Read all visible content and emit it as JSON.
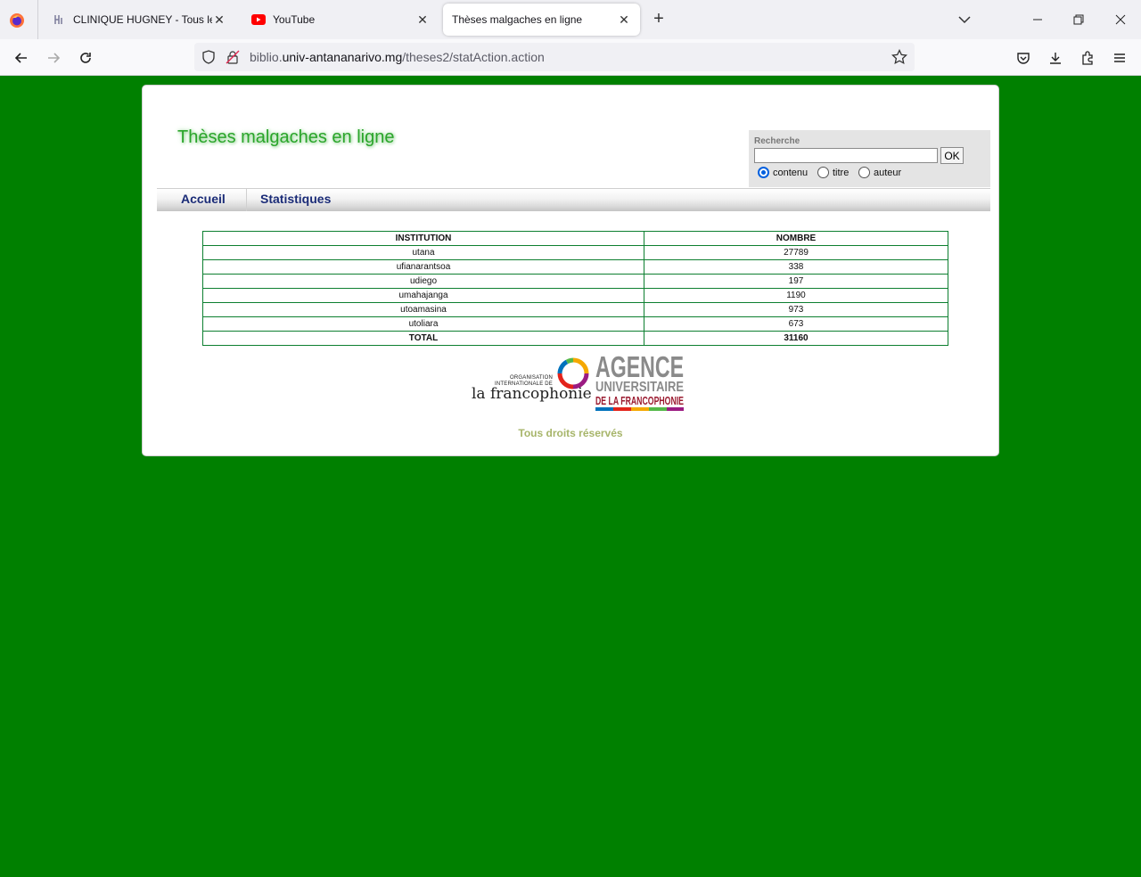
{
  "browser": {
    "tabs": [
      {
        "title": "CLINIQUE HUGNEY - Tous les fa",
        "icon": "clinique-favicon",
        "active": false
      },
      {
        "title": "YouTube",
        "icon": "youtube-icon",
        "active": false
      },
      {
        "title": "Thèses malgaches en ligne",
        "icon": "",
        "active": true
      }
    ],
    "url": {
      "prefix": "biblio.",
      "domain": "univ-antananarivo.mg",
      "path": "/theses2/statAction.action"
    }
  },
  "site": {
    "title": "Thèses malgaches en ligne",
    "search": {
      "label": "Recherche",
      "value": "",
      "button": "OK",
      "options": [
        "contenu",
        "titre",
        "auteur"
      ],
      "selected": "contenu"
    },
    "menu": [
      "Accueil",
      "Statistiques"
    ]
  },
  "stats": {
    "headers": [
      "INSTITUTION",
      "NOMBRE"
    ],
    "rows": [
      {
        "institution": "utana",
        "nombre": "27789"
      },
      {
        "institution": "ufianarantsoa",
        "nombre": "338"
      },
      {
        "institution": "udiego",
        "nombre": "197"
      },
      {
        "institution": "umahajanga",
        "nombre": "1190"
      },
      {
        "institution": "utoamasina",
        "nombre": "973"
      },
      {
        "institution": "utoliara",
        "nombre": "673"
      }
    ],
    "total": {
      "label": "TOTAL",
      "value": "31160"
    }
  },
  "logos": {
    "oif": {
      "line1": "ORGANISATION",
      "line2": "INTERNATIONALE DE",
      "name": "la francophonie"
    },
    "auf": {
      "line1": "AGENCE",
      "line2": "UNIVERSITAIRE",
      "line3": "DE LA FRANCOPHONIE"
    }
  },
  "footer": "Tous droits réservés",
  "colors": {
    "page_background": "#008000",
    "table_border": "#0d7f30",
    "menu_text": "#1a2b77",
    "title": "#2aa52a",
    "footer": "#a7b56a"
  }
}
